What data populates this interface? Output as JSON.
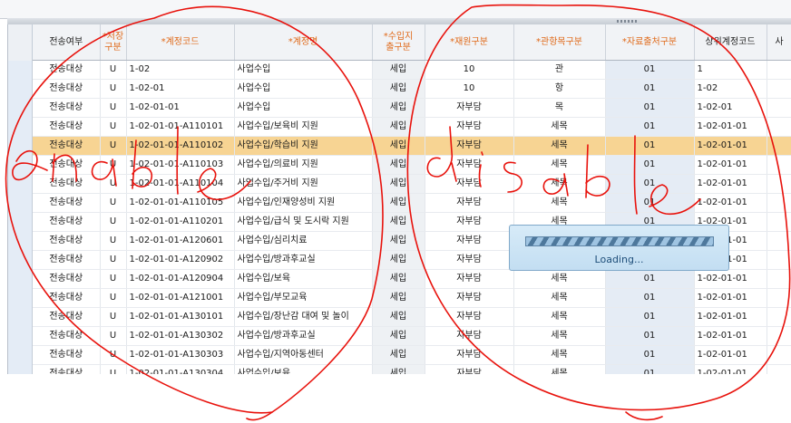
{
  "grid": {
    "columns": [
      {
        "label": "전송여부",
        "required": false
      },
      {
        "label": "*저장\n구분",
        "required": true
      },
      {
        "label": "*계정코드",
        "required": true
      },
      {
        "label": "*계정명",
        "required": true
      },
      {
        "label": "*수입지\n출구분",
        "required": true
      },
      {
        "label": "*재원구분",
        "required": true
      },
      {
        "label": "*관항목구분",
        "required": true
      },
      {
        "label": "*자료출처구분",
        "required": true
      },
      {
        "label": "상위계정코드",
        "required": false
      },
      {
        "label": "사",
        "required": false
      }
    ],
    "selected_row": 4,
    "rows": [
      [
        "전송대상",
        "U",
        "1-02",
        "사업수입",
        "세입",
        "10",
        "관",
        "01",
        "1"
      ],
      [
        "전송대상",
        "U",
        "1-02-01",
        "사업수입",
        "세입",
        "10",
        "항",
        "01",
        "1-02"
      ],
      [
        "전송대상",
        "U",
        "1-02-01-01",
        "사업수입",
        "세입",
        "자부담",
        "목",
        "01",
        "1-02-01"
      ],
      [
        "전송대상",
        "U",
        "1-02-01-01-A110101",
        "사업수입/보육비 지원",
        "세입",
        "자부담",
        "세목",
        "01",
        "1-02-01-01"
      ],
      [
        "전송대상",
        "U",
        "1-02-01-01-A110102",
        "사업수입/학습비 지원",
        "세입",
        "자부담",
        "세목",
        "01",
        "1-02-01-01"
      ],
      [
        "전송대상",
        "U",
        "1-02-01-01-A110103",
        "사업수입/의료비 지원",
        "세입",
        "자부담",
        "세목",
        "01",
        "1-02-01-01"
      ],
      [
        "전송대상",
        "U",
        "1-02-01-01-A110104",
        "사업수입/주거비 지원",
        "세입",
        "자부담",
        "세목",
        "01",
        "1-02-01-01"
      ],
      [
        "전송대상",
        "U",
        "1-02-01-01-A110105",
        "사업수입/인재양성비 지원",
        "세입",
        "자부담",
        "세목",
        "01",
        "1-02-01-01"
      ],
      [
        "전송대상",
        "U",
        "1-02-01-01-A110201",
        "사업수입/급식 및 도시락 지원",
        "세입",
        "자부담",
        "세목",
        "01",
        "1-02-01-01"
      ],
      [
        "전송대상",
        "U",
        "1-02-01-01-A120601",
        "사업수입/심리치료",
        "세입",
        "자부담",
        "세목",
        "01",
        "1-02-01-01"
      ],
      [
        "전송대상",
        "U",
        "1-02-01-01-A120902",
        "사업수입/방과후교실",
        "세입",
        "자부담",
        "세목",
        "01",
        "1-02-01-01"
      ],
      [
        "전송대상",
        "U",
        "1-02-01-01-A120904",
        "사업수입/보육",
        "세입",
        "자부담",
        "세목",
        "01",
        "1-02-01-01"
      ],
      [
        "전송대상",
        "U",
        "1-02-01-01-A121001",
        "사업수입/부모교육",
        "세입",
        "자부담",
        "세목",
        "01",
        "1-02-01-01"
      ],
      [
        "전송대상",
        "U",
        "1-02-01-01-A130101",
        "사업수입/장난감 대여 및 놀이",
        "세입",
        "자부담",
        "세목",
        "01",
        "1-02-01-01"
      ],
      [
        "전송대상",
        "U",
        "1-02-01-01-A130302",
        "사업수입/방과후교실",
        "세입",
        "자부담",
        "세목",
        "01",
        "1-02-01-01"
      ],
      [
        "전송대상",
        "U",
        "1-02-01-01-A130303",
        "사업수입/지역아동센터",
        "세입",
        "자부담",
        "세목",
        "01",
        "1-02-01-01"
      ],
      [
        "전송대상",
        "U",
        "1-02-01-01-A130304",
        "사업수입/보육",
        "세입",
        "자부담",
        "세목",
        "01",
        "1-02-01-01"
      ]
    ]
  },
  "loading": {
    "text": "Loading...",
    "progress": 1.0
  },
  "annotation": {
    "left_text": "enable",
    "right_text": "disable",
    "color": "#e8120c"
  },
  "colors": {
    "required_header": "#e06a1a",
    "selected_row": "#f7d493",
    "loading_bg": "#c9e2f4"
  }
}
